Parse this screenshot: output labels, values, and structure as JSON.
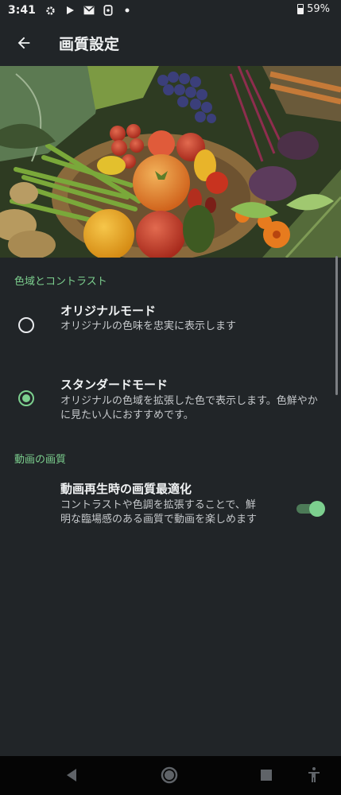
{
  "status_bar": {
    "time": "3:41",
    "battery_percent": "59%",
    "icons": [
      "settings-gear-icon",
      "play-store-icon",
      "gmail-icon",
      "ring-app-icon",
      "notification-dot-icon"
    ]
  },
  "app_bar": {
    "back_icon": "arrow-back-icon",
    "title": "画質設定"
  },
  "hero": {
    "image": "vegetables-basket-photo"
  },
  "sections": [
    {
      "header": "色域とコントラスト",
      "options": [
        {
          "title": "オリジナルモード",
          "description": "オリジナルの色味を忠実に表示します",
          "selected": false
        },
        {
          "title": "スタンダードモード",
          "description": "オリジナルの色域を拡張した色で表示します。色鮮やかに見たい人におすすめです。",
          "selected": true
        }
      ]
    },
    {
      "header": "動画の画質",
      "options": [
        {
          "title": "動画再生時の画質最適化",
          "description": "コントラストや色調を拡張することで、鮮明な臨場感のある画質で動画を楽しめます",
          "toggle_on": true
        }
      ]
    }
  ],
  "colors": {
    "background": "#212528",
    "accent": "#7ccf8e",
    "text_primary": "#f1f3f4",
    "text_secondary": "#c6c9cc"
  },
  "nav_bar": {
    "buttons": [
      "back-triangle-icon",
      "home-circle-icon",
      "recents-square-icon",
      "accessibility-icon"
    ]
  }
}
